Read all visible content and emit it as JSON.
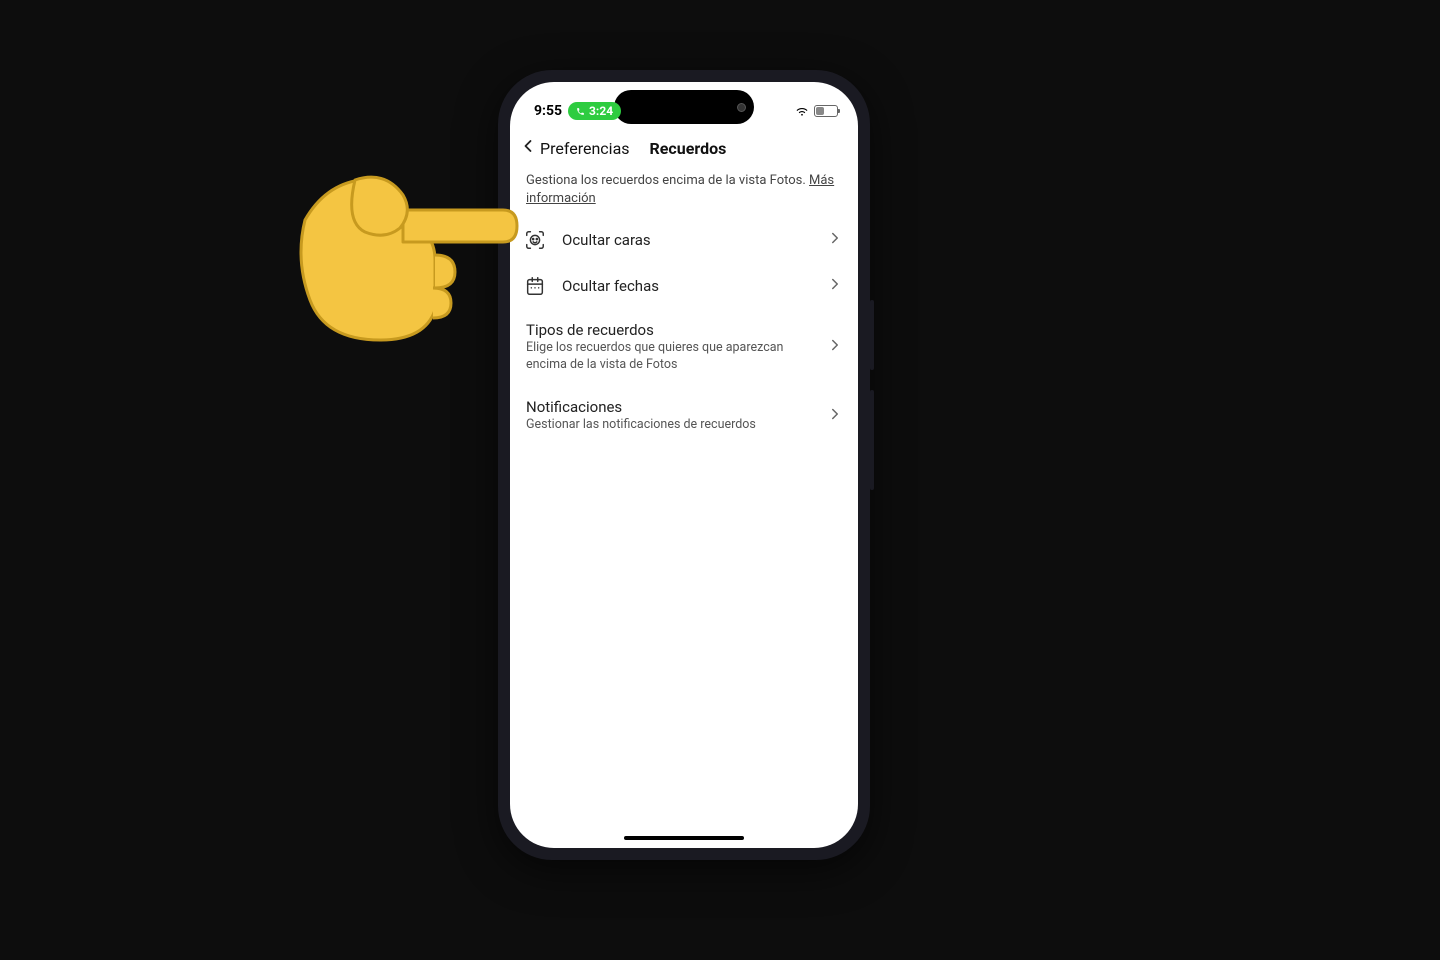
{
  "status": {
    "time": "9:55",
    "call_time": "3:24"
  },
  "nav": {
    "back_label": "Preferencias",
    "title": "Recuerdos"
  },
  "description": {
    "text": "Gestiona los recuerdos encima de la vista Fotos. ",
    "link": "Más información"
  },
  "rows": {
    "hide_faces": {
      "title": "Ocultar caras"
    },
    "hide_dates": {
      "title": "Ocultar fechas"
    },
    "types": {
      "title": "Tipos de recuerdos",
      "sub": "Elige los recuerdos que quieres que aparezcan encima de la vista de Fotos"
    },
    "notifications": {
      "title": "Notificaciones",
      "sub": "Gestionar las notificaciones de recuerdos"
    }
  }
}
